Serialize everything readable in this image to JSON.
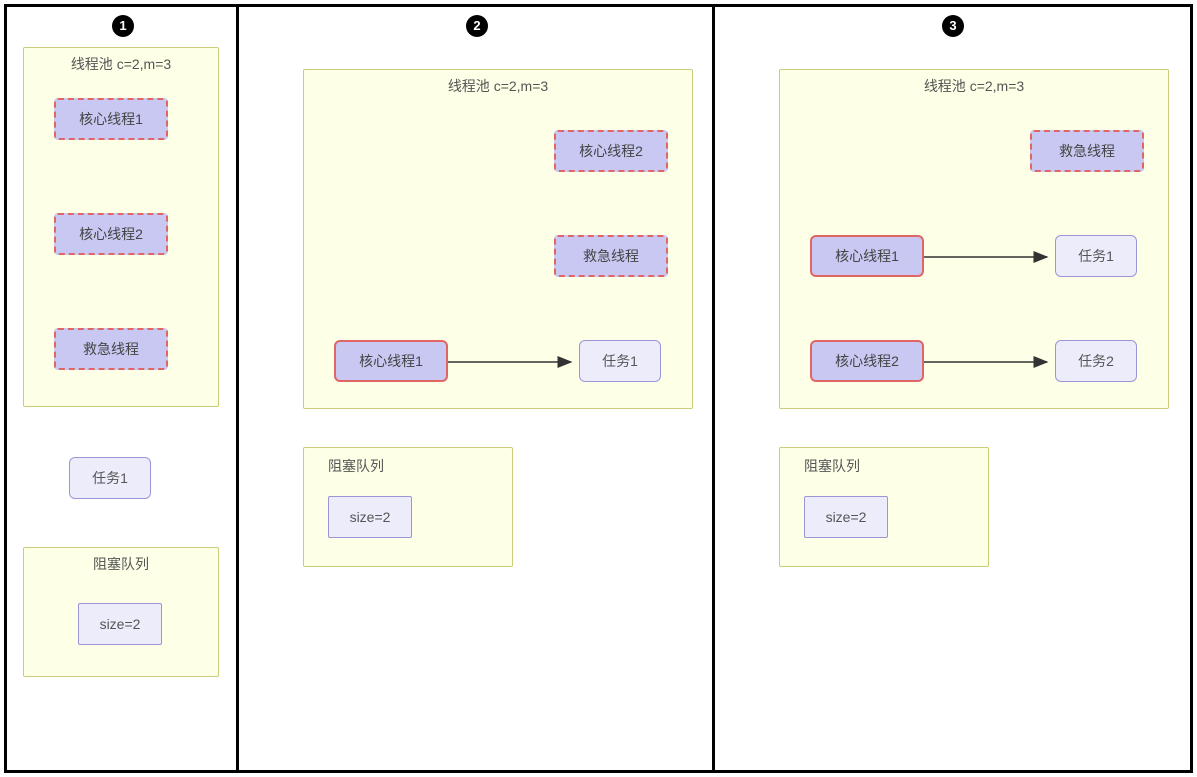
{
  "badges": [
    "1",
    "2",
    "3"
  ],
  "panel1": {
    "poolTitle": "线程池 c=2,m=3",
    "core1": "核心线程1",
    "core2": "核心线程2",
    "emergency": "救急线程",
    "task1": "任务1",
    "queueTitle": "阻塞队列",
    "size": "size=2"
  },
  "panel2": {
    "poolTitle": "线程池 c=2,m=3",
    "core2": "核心线程2",
    "emergency": "救急线程",
    "core1": "核心线程1",
    "task1": "任务1",
    "queueTitle": "阻塞队列",
    "size": "size=2"
  },
  "panel3": {
    "poolTitle": "线程池 c=2,m=3",
    "emergency": "救急线程",
    "core1": "核心线程1",
    "task1": "任务1",
    "core2": "核心线程2",
    "task2": "任务2",
    "queueTitle": "阻塞队列",
    "size": "size=2"
  }
}
